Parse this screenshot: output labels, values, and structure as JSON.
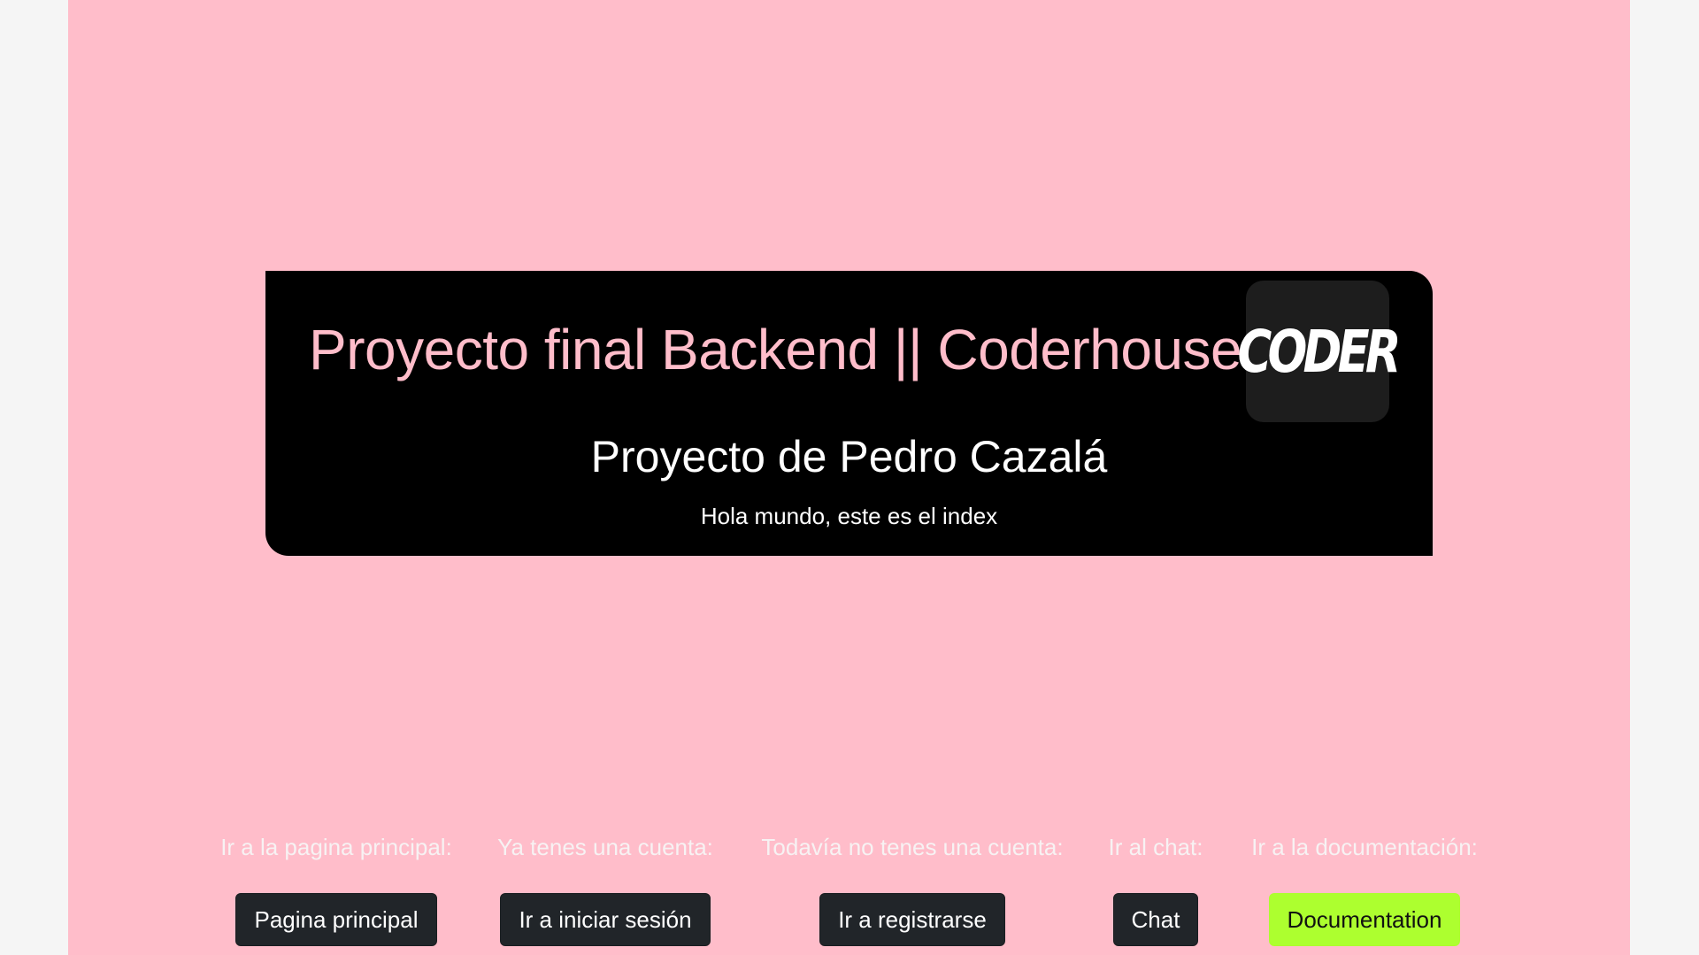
{
  "hero": {
    "title": "Proyecto final Backend || Coderhouse",
    "logo_text": "CODER",
    "subtitle": "Proyecto de Pedro Cazalá",
    "text": "Hola mundo, este es el index"
  },
  "nav": [
    {
      "label": "Ir a la pagina principal:",
      "button": "Pagina principal"
    },
    {
      "label": "Ya tenes una cuenta:",
      "button": "Ir a iniciar sesión"
    },
    {
      "label": "Todavía no tenes una cuenta:",
      "button": "Ir a registrarse"
    },
    {
      "label": "Ir al chat:",
      "button": "Chat"
    },
    {
      "label": "Ir a la documentación:",
      "button": "Documentation"
    }
  ],
  "colors": {
    "page_background": "#ffbdca",
    "hero_background": "#000000",
    "button_dark": "#212529",
    "button_doc": "#adff2f"
  }
}
